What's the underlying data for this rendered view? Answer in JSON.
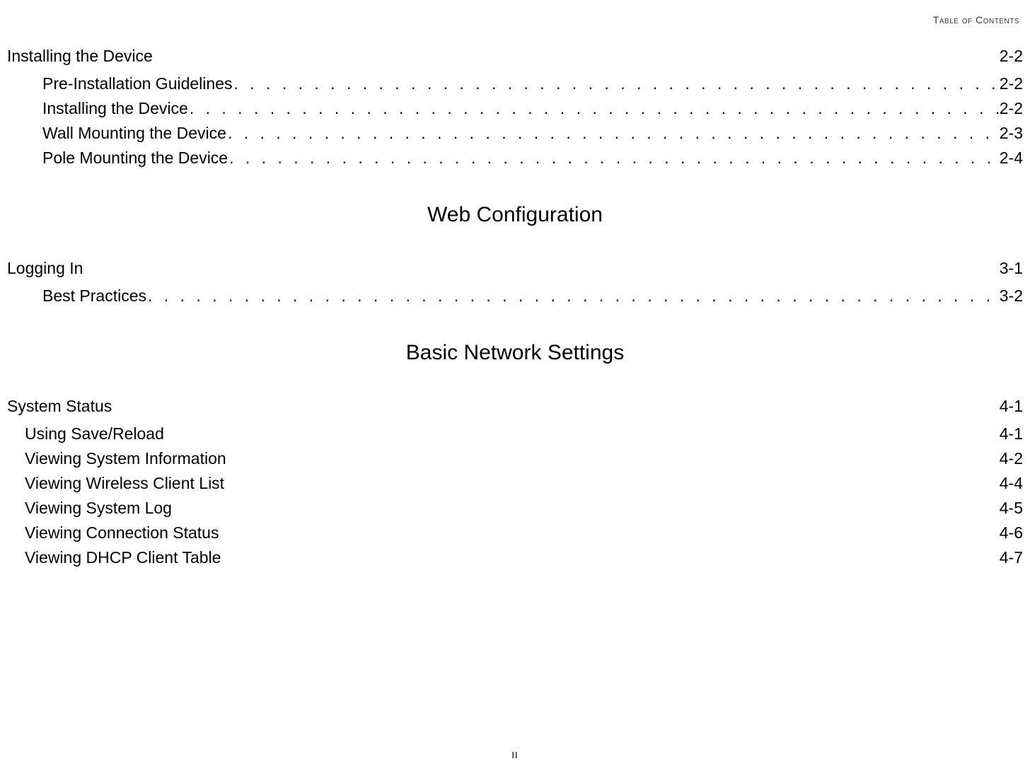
{
  "header": "Table of Contents",
  "sections": [
    {
      "chapter": {
        "title": "Installing the Device",
        "page": "2-2"
      },
      "entries": [
        {
          "title": "Pre-Installation Guidelines",
          "page": "2-2",
          "dotted": true
        },
        {
          "title": "Installing the Device",
          "page": "2-2",
          "dotted": true
        },
        {
          "title": "Wall Mounting the Device",
          "page": "2-3",
          "dotted": true
        },
        {
          "title": "Pole Mounting the Device",
          "page": "2-4",
          "dotted": true
        }
      ]
    },
    {
      "heading": "Web Configuration",
      "chapter": {
        "title": "Logging In",
        "page": "3-1"
      },
      "entries": [
        {
          "title": "Best Practices",
          "page": "3-2",
          "dotted": true
        }
      ]
    },
    {
      "heading": "Basic Network Settings",
      "chapter": {
        "title": "System Status",
        "page": "4-1"
      },
      "entries": [
        {
          "title": "Using Save/Reload",
          "page": "4-1",
          "dotted": false
        },
        {
          "title": "Viewing System Information",
          "page": "4-2",
          "dotted": false
        },
        {
          "title": "Viewing Wireless Client List",
          "page": "4-4",
          "dotted": false
        },
        {
          "title": "Viewing System Log",
          "page": "4-5",
          "dotted": false
        },
        {
          "title": "Viewing Connection Status",
          "page": "4-6",
          "dotted": false
        },
        {
          "title": "Viewing DHCP Client Table",
          "page": "4-7",
          "dotted": false
        }
      ]
    }
  ],
  "dotFiller": ". . . . . . . . . . . . . . . . . . . . . . . . . . . . . . . . . . . . . . . . . . . . . . . . . . . . . . . . . . . . . . . . . . . . . . . . . . . . . . . . . . . . . . . . . . . . . . . . . . . . . . . . . . . . . . . . . . . . . . . . . . . . . . . . . . . . . . . . . . . . . . . . . . . . . . . . . . . .",
  "pageNumber": "II"
}
